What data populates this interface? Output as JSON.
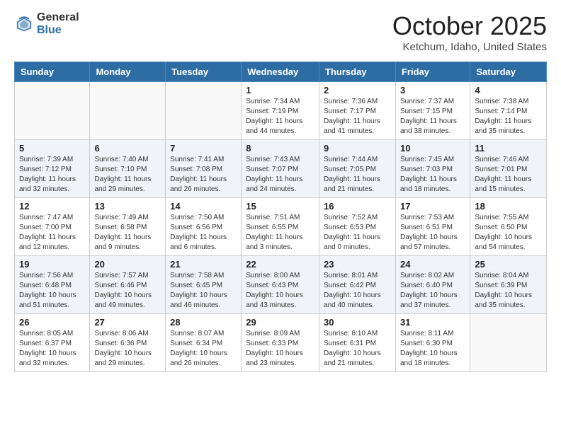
{
  "header": {
    "logo_general": "General",
    "logo_blue": "Blue",
    "month": "October 2025",
    "location": "Ketchum, Idaho, United States"
  },
  "weekdays": [
    "Sunday",
    "Monday",
    "Tuesday",
    "Wednesday",
    "Thursday",
    "Friday",
    "Saturday"
  ],
  "weeks": [
    [
      {
        "day": "",
        "info": ""
      },
      {
        "day": "",
        "info": ""
      },
      {
        "day": "",
        "info": ""
      },
      {
        "day": "1",
        "info": "Sunrise: 7:34 AM\nSunset: 7:19 PM\nDaylight: 11 hours and 44 minutes."
      },
      {
        "day": "2",
        "info": "Sunrise: 7:36 AM\nSunset: 7:17 PM\nDaylight: 11 hours and 41 minutes."
      },
      {
        "day": "3",
        "info": "Sunrise: 7:37 AM\nSunset: 7:15 PM\nDaylight: 11 hours and 38 minutes."
      },
      {
        "day": "4",
        "info": "Sunrise: 7:38 AM\nSunset: 7:14 PM\nDaylight: 11 hours and 35 minutes."
      }
    ],
    [
      {
        "day": "5",
        "info": "Sunrise: 7:39 AM\nSunset: 7:12 PM\nDaylight: 11 hours and 32 minutes."
      },
      {
        "day": "6",
        "info": "Sunrise: 7:40 AM\nSunset: 7:10 PM\nDaylight: 11 hours and 29 minutes."
      },
      {
        "day": "7",
        "info": "Sunrise: 7:41 AM\nSunset: 7:08 PM\nDaylight: 11 hours and 26 minutes."
      },
      {
        "day": "8",
        "info": "Sunrise: 7:43 AM\nSunset: 7:07 PM\nDaylight: 11 hours and 24 minutes."
      },
      {
        "day": "9",
        "info": "Sunrise: 7:44 AM\nSunset: 7:05 PM\nDaylight: 11 hours and 21 minutes."
      },
      {
        "day": "10",
        "info": "Sunrise: 7:45 AM\nSunset: 7:03 PM\nDaylight: 11 hours and 18 minutes."
      },
      {
        "day": "11",
        "info": "Sunrise: 7:46 AM\nSunset: 7:01 PM\nDaylight: 11 hours and 15 minutes."
      }
    ],
    [
      {
        "day": "12",
        "info": "Sunrise: 7:47 AM\nSunset: 7:00 PM\nDaylight: 11 hours and 12 minutes."
      },
      {
        "day": "13",
        "info": "Sunrise: 7:49 AM\nSunset: 6:58 PM\nDaylight: 11 hours and 9 minutes."
      },
      {
        "day": "14",
        "info": "Sunrise: 7:50 AM\nSunset: 6:56 PM\nDaylight: 11 hours and 6 minutes."
      },
      {
        "day": "15",
        "info": "Sunrise: 7:51 AM\nSunset: 6:55 PM\nDaylight: 11 hours and 3 minutes."
      },
      {
        "day": "16",
        "info": "Sunrise: 7:52 AM\nSunset: 6:53 PM\nDaylight: 11 hours and 0 minutes."
      },
      {
        "day": "17",
        "info": "Sunrise: 7:53 AM\nSunset: 6:51 PM\nDaylight: 10 hours and 57 minutes."
      },
      {
        "day": "18",
        "info": "Sunrise: 7:55 AM\nSunset: 6:50 PM\nDaylight: 10 hours and 54 minutes."
      }
    ],
    [
      {
        "day": "19",
        "info": "Sunrise: 7:56 AM\nSunset: 6:48 PM\nDaylight: 10 hours and 51 minutes."
      },
      {
        "day": "20",
        "info": "Sunrise: 7:57 AM\nSunset: 6:46 PM\nDaylight: 10 hours and 49 minutes."
      },
      {
        "day": "21",
        "info": "Sunrise: 7:58 AM\nSunset: 6:45 PM\nDaylight: 10 hours and 46 minutes."
      },
      {
        "day": "22",
        "info": "Sunrise: 8:00 AM\nSunset: 6:43 PM\nDaylight: 10 hours and 43 minutes."
      },
      {
        "day": "23",
        "info": "Sunrise: 8:01 AM\nSunset: 6:42 PM\nDaylight: 10 hours and 40 minutes."
      },
      {
        "day": "24",
        "info": "Sunrise: 8:02 AM\nSunset: 6:40 PM\nDaylight: 10 hours and 37 minutes."
      },
      {
        "day": "25",
        "info": "Sunrise: 8:04 AM\nSunset: 6:39 PM\nDaylight: 10 hours and 35 minutes."
      }
    ],
    [
      {
        "day": "26",
        "info": "Sunrise: 8:05 AM\nSunset: 6:37 PM\nDaylight: 10 hours and 32 minutes."
      },
      {
        "day": "27",
        "info": "Sunrise: 8:06 AM\nSunset: 6:36 PM\nDaylight: 10 hours and 29 minutes."
      },
      {
        "day": "28",
        "info": "Sunrise: 8:07 AM\nSunset: 6:34 PM\nDaylight: 10 hours and 26 minutes."
      },
      {
        "day": "29",
        "info": "Sunrise: 8:09 AM\nSunset: 6:33 PM\nDaylight: 10 hours and 23 minutes."
      },
      {
        "day": "30",
        "info": "Sunrise: 8:10 AM\nSunset: 6:31 PM\nDaylight: 10 hours and 21 minutes."
      },
      {
        "day": "31",
        "info": "Sunrise: 8:11 AM\nSunset: 6:30 PM\nDaylight: 10 hours and 18 minutes."
      },
      {
        "day": "",
        "info": ""
      }
    ]
  ]
}
